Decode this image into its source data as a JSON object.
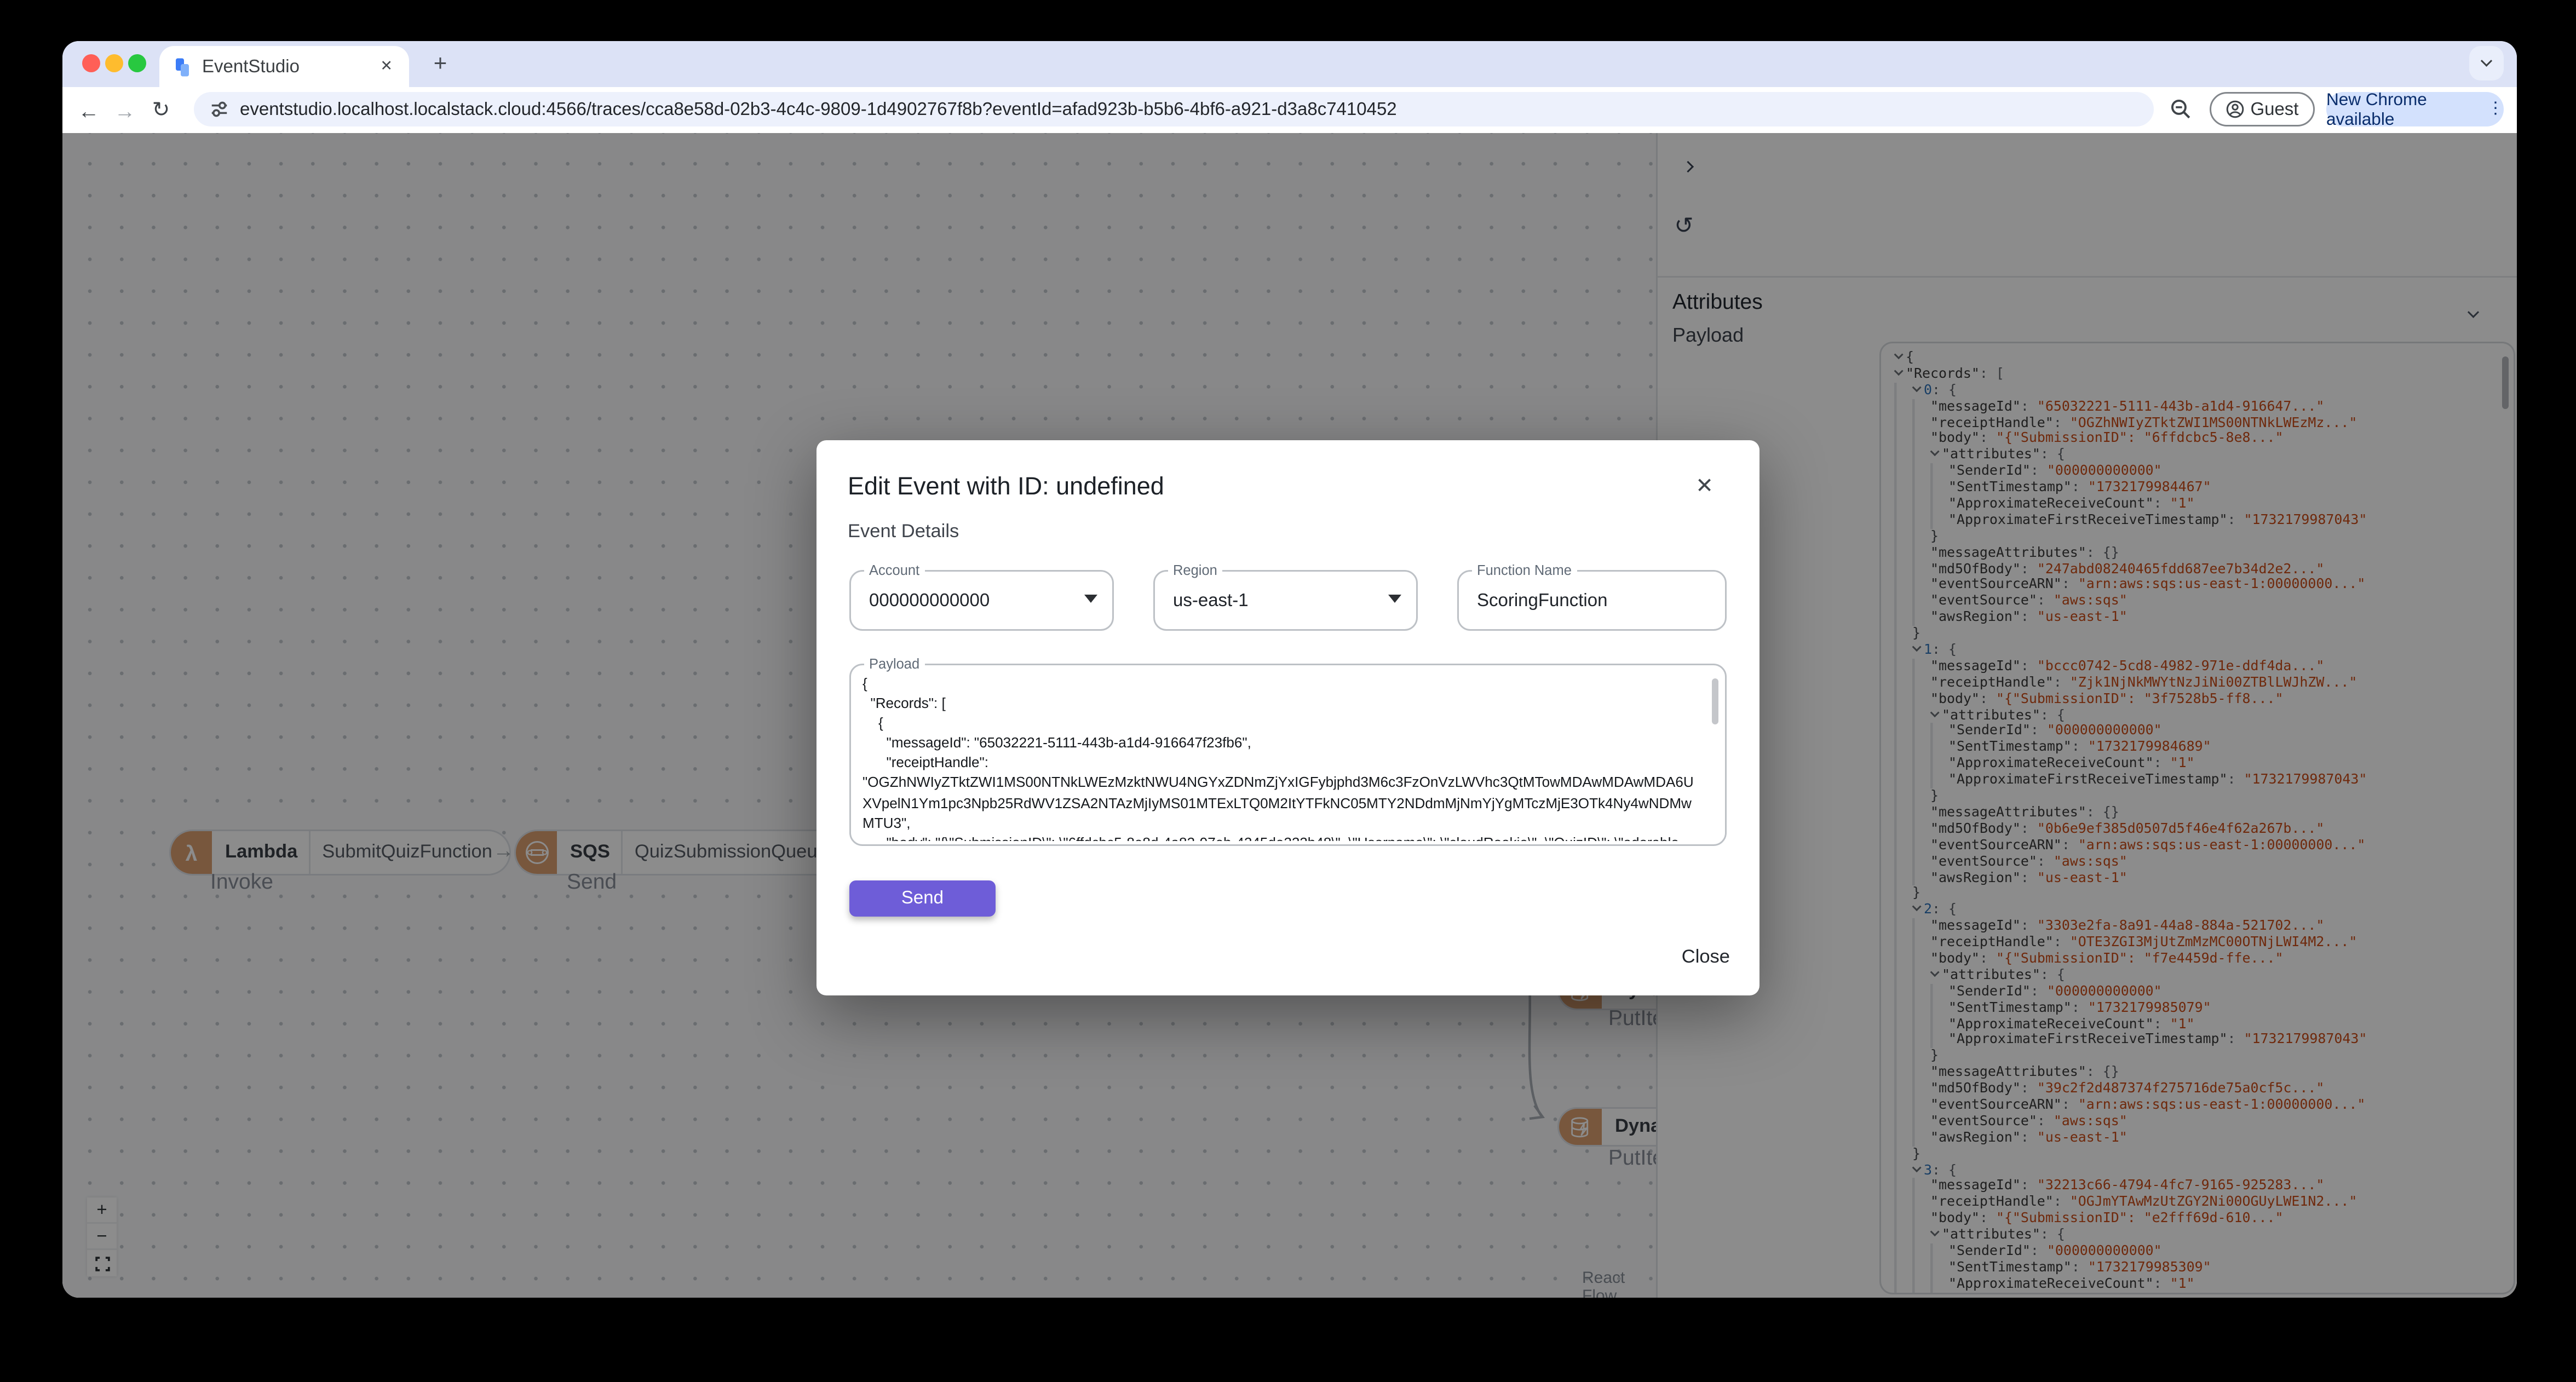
{
  "browser": {
    "tab_title": "EventStudio",
    "url": "eventstudio.localhost.localstack.cloud:4566/traces/cca8e58d-02b3-4c4c-9809-1d4902767f8b?eventId=afad923b-b5b6-4bf6-a921-d3a8c7410452",
    "guest_label": "Guest",
    "update_label": "New Chrome available"
  },
  "canvas": {
    "nodes": [
      {
        "service": "Lambda",
        "name": "SubmitQuizFunction",
        "op_label": "Invoke"
      },
      {
        "service": "SQS",
        "name": "QuizSubmissionQueue",
        "op_label": "Send"
      },
      {
        "service": "DynamoDB",
        "name": "DynamoDB",
        "op_label": "PutItem"
      },
      {
        "service": "DynamoDB",
        "name": "DynamoDB",
        "op_label": "PutItem"
      }
    ],
    "attribution": "React Flow"
  },
  "panel": {
    "attributes_label": "Attributes",
    "payload_label": "Payload",
    "records": [
      {
        "idx": "0",
        "messageId": "65032221-5111-443b-a1d4-916647...",
        "receiptHandle": "OGZhNWIyZTktZWI1MS00NTNkLWEzMz...",
        "body": "{\"SubmissionID\": \"6ffdcbc5-8e8...",
        "attributes": {
          "SenderId": "000000000000",
          "SentTimestamp": "1732179984467",
          "ApproximateReceiveCount": "1",
          "ApproximateFirstReceiveTimestamp": "1732179987043"
        },
        "messageAttributes": "{}",
        "md5OfBody": "247abd08240465fdd687ee7b34d2e2...",
        "eventSourceARN": "arn:aws:sqs:us-east-1:00000000...",
        "eventSource": "aws:sqs",
        "awsRegion": "us-east-1"
      },
      {
        "idx": "1",
        "messageId": "bccc0742-5cd8-4982-971e-ddf4da...",
        "receiptHandle": "Zjk1NjNkMWYtNzJiNi00ZTBlLWJhZW...",
        "body": "{\"SubmissionID\": \"3f7528b5-ff8...",
        "attributes": {
          "SenderId": "000000000000",
          "SentTimestamp": "1732179984689",
          "ApproximateReceiveCount": "1",
          "ApproximateFirstReceiveTimestamp": "1732179987043"
        },
        "messageAttributes": "{}",
        "md5OfBody": "0b6e9ef385d0507d5f46e4f62a267b...",
        "eventSourceARN": "arn:aws:sqs:us-east-1:00000000...",
        "eventSource": "aws:sqs",
        "awsRegion": "us-east-1"
      },
      {
        "idx": "2",
        "messageId": "3303e2fa-8a91-44a8-884a-521702...",
        "receiptHandle": "OTE3ZGI3MjUtZmMzMC00OTNjLWI4M2...",
        "body": "{\"SubmissionID\": \"f7e4459d-ffe...",
        "attributes": {
          "SenderId": "000000000000",
          "SentTimestamp": "1732179985079",
          "ApproximateReceiveCount": "1",
          "ApproximateFirstReceiveTimestamp": "1732179987043"
        },
        "messageAttributes": "{}",
        "md5OfBody": "39c2f2d487374f275716de75a0cf5c...",
        "eventSourceARN": "arn:aws:sqs:us-east-1:00000000...",
        "eventSource": "aws:sqs",
        "awsRegion": "us-east-1"
      },
      {
        "idx": "3",
        "messageId": "32213c66-4794-4fc7-9165-925283...",
        "receiptHandle": "OGJmYTAwMzUtZGY2Ni00OGUyLWE1N2...",
        "body": "{\"SubmissionID\": \"e2fff69d-610...",
        "attributes": {
          "SenderId": "000000000000",
          "SentTimestamp": "1732179985309",
          "ApproximateReceiveCount": "1"
        },
        "partial": true
      }
    ]
  },
  "modal": {
    "title": "Edit Event with ID: undefined",
    "subtitle": "Event Details",
    "fields": {
      "account_label": "Account",
      "account_value": "000000000000",
      "region_label": "Region",
      "region_value": "us-east-1",
      "function_label": "Function Name",
      "function_value": "ScoringFunction",
      "payload_label": "Payload"
    },
    "payload_text": "{\n  \"Records\": [\n    {\n      \"messageId\": \"65032221-5111-443b-a1d4-916647f23fb6\",\n      \"receiptHandle\":\n\"OGZhNWIyZTktZWI1MS00NTNkLWEzMzktNWU4NGYxZDNmZjYxIGFybjphd3M6c3FzOnVzLWVhc3QtMTowMDAwMDAwMDA6UXVpelN1Ym1pc3Npb25RdWV1ZSA2NTAzMjIyMS01MTExLTQ0M2ItYTFkNC05MTY2NDdmMjNmYjYgMTczMjE3OTk4Ny4wNDMwMTU3\",\n      \"body\": \"{\\\"SubmissionID\\\": \\\"6ffdcbc5-8e8d-4a82-97eb-4245de222b48\\\", \\\"Username\\\": \\\"cloudRookie\\\", \\\"QuizID\\\": \\\"adorable-",
    "send_label": "Send",
    "close_label": "Close"
  },
  "colors": {
    "accent_purple": "#6e5dd8",
    "aws_icon_tan": "#db9e70",
    "json_string": "#cb4b16",
    "json_index": "#2d72b8",
    "update_pill_bg": "#d3e1fd",
    "update_pill_text": "#0a2d6b"
  }
}
